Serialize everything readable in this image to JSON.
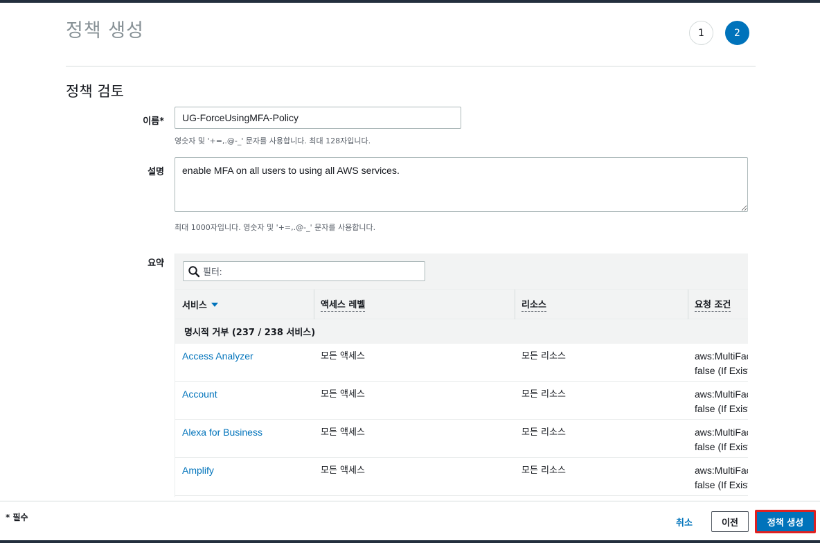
{
  "page": {
    "title": "정책 생성",
    "steps": [
      "1",
      "2"
    ],
    "section_title": "정책 검토"
  },
  "form": {
    "name_label": "이름*",
    "name_value": "UG-ForceUsingMFA-Policy",
    "name_hint": "영숫자 및 '+=,.@-_' 문자를 사용합니다. 최대 128자입니다.",
    "desc_label": "설명",
    "desc_value": "enable MFA on all users to using all AWS services.",
    "desc_hint": "최대 1000자입니다. 영숫자 및 '+=,.@-_' 문자를 사용합니다.",
    "summary_label": "요약"
  },
  "summary_table": {
    "filter_placeholder": "필터:",
    "columns": [
      "서비스",
      "액세스 레벨",
      "리소스",
      "요청 조건"
    ],
    "group_label": "명시적 거부 (237 / 238 서비스)",
    "rows": [
      {
        "service": "Access Analyzer",
        "access": "모든 액세스",
        "resource": "모든 리소스",
        "cond1": "aws:MultiFac",
        "cond2": "false (If Exist"
      },
      {
        "service": "Account",
        "access": "모든 액세스",
        "resource": "모든 리소스",
        "cond1": "aws:MultiFac",
        "cond2": "false (If Exist"
      },
      {
        "service": "Alexa for Business",
        "access": "모든 액세스",
        "resource": "모든 리소스",
        "cond1": "aws:MultiFac",
        "cond2": "false (If Exist"
      },
      {
        "service": "Amplify",
        "access": "모든 액세스",
        "resource": "모든 리소스",
        "cond1": "aws:MultiFac",
        "cond2": "false (If Exist"
      }
    ]
  },
  "footer": {
    "required_note": "* 필수",
    "cancel_label": "취소",
    "prev_label": "이전",
    "create_label": "정책 생성"
  },
  "colors": {
    "accent": "#0073bb",
    "highlight": "#e02020"
  },
  "icons": {
    "filter": "search-icon",
    "sort": "caret-down-icon"
  }
}
